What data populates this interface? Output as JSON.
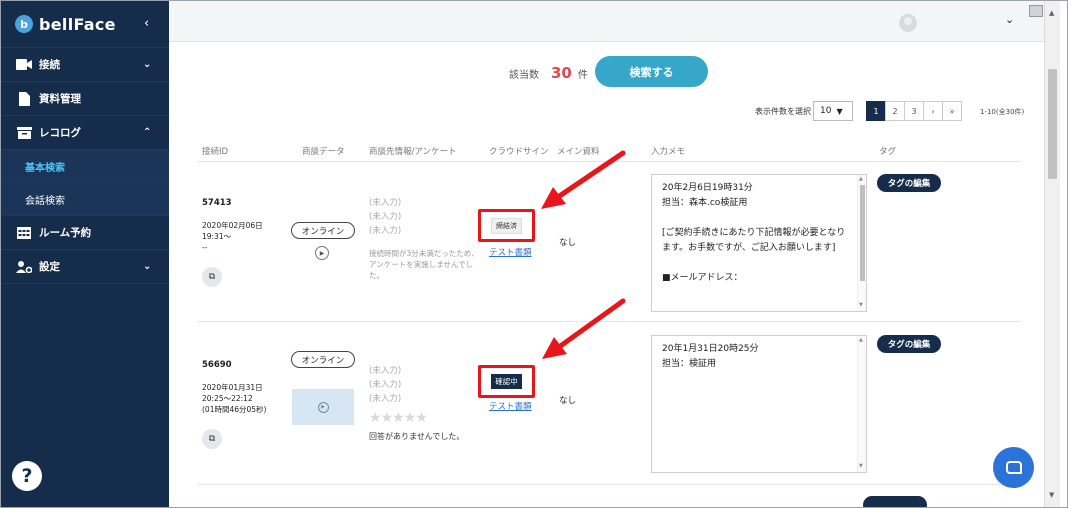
{
  "brand": {
    "name": "bellFace",
    "logo": "b",
    "collapse": "‹"
  },
  "sidebar": {
    "items": [
      {
        "label": "接続",
        "icon": "video-icon",
        "chev": "⌄"
      },
      {
        "label": "資料管理",
        "icon": "document-icon"
      },
      {
        "label": "レコログ",
        "icon": "archive-icon",
        "chev": "⌃"
      },
      {
        "label": "基本検索",
        "sub": true,
        "active": true
      },
      {
        "label": "会話検索",
        "sub": true
      },
      {
        "label": "ルーム予約",
        "icon": "calendar-icon"
      },
      {
        "label": "設定",
        "icon": "user-settings-icon",
        "chev": "⌄"
      }
    ],
    "help": "?"
  },
  "topbar": {
    "user_chev": "⌄"
  },
  "search": {
    "count_label": "該当数",
    "count": "30",
    "count_unit": "件",
    "button": "検索する"
  },
  "pagination": {
    "perpage_label": "表示件数を選択",
    "perpage_value": "10",
    "pages": [
      "1",
      "2",
      "3",
      "›",
      "»"
    ],
    "range": "1-10(全30件)"
  },
  "table": {
    "headers": [
      "接続ID",
      "商談データ",
      "商談先情報/アンケート",
      "クラウドサイン",
      "メイン資料",
      "入力メモ",
      "タグ"
    ]
  },
  "rows": [
    {
      "id": "57413",
      "datetime": "2020年02月06日\n19:31～\n--",
      "online": "オンライン",
      "customer": "(未入力)\n(未入力)\n(未入力)",
      "note": "接続時間が3分未満だったため、アンケートを実施しませんでした。",
      "sign_status": "締結済",
      "doc_link": "テスト書類",
      "main_doc": "なし",
      "memo": "20年2月6日19時31分\n担当：森本.co検証用\n\n[ご契約手続きにあたり下記情報が必要となります。お手数ですが、ご記入お願いします]\n\n■メールアドレス：",
      "tag_button": "タグの編集"
    },
    {
      "id": "56690",
      "datetime": "2020年01月31日\n20:25～22:12\n(01時間46分05秒)",
      "online": "オンライン",
      "customer": "(未入力)\n(未入力)\n(未入力)",
      "stars": "★★★★★",
      "no_answer": "回答がありませんでした。",
      "sign_status": "確認中",
      "doc_link": "テスト書類",
      "main_doc": "なし",
      "memo": "20年1月31日20時25分\n担当：検証用",
      "tag_button": "タグの編集"
    }
  ],
  "colors": {
    "sidebar": "#152d4a",
    "accent": "#37a7c9",
    "count": "#e5484d",
    "highlight": "#e8151b",
    "link": "#2a6fd6"
  }
}
